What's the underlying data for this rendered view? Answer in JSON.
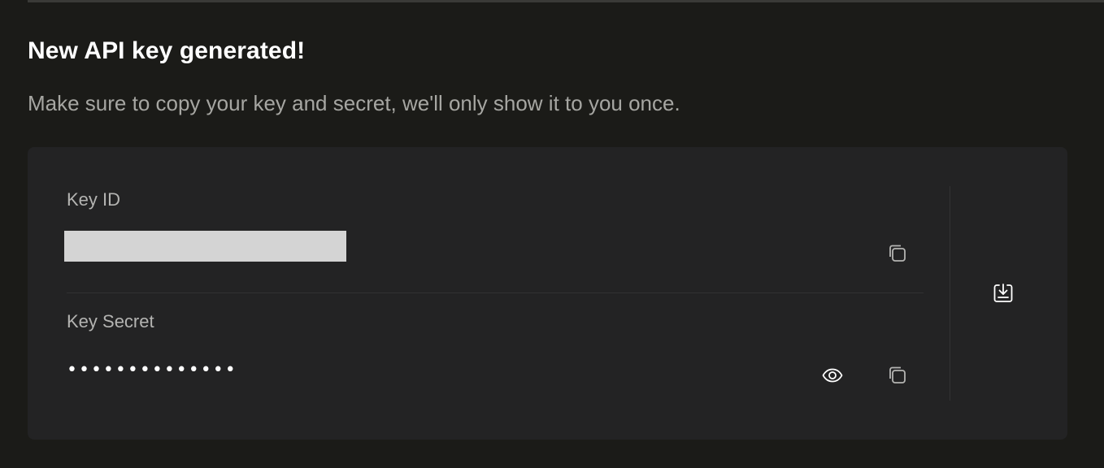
{
  "dialog": {
    "title": "New API key generated!",
    "subtitle": "Make sure to copy your key and secret, we'll only show it to you once."
  },
  "fields": {
    "key_id": {
      "label": "Key ID",
      "value": ""
    },
    "key_secret": {
      "label": "Key Secret",
      "value": "••••••••••••••"
    }
  },
  "icons": {
    "copy": "copy-icon",
    "reveal": "eye-icon",
    "download": "download-icon"
  },
  "colors": {
    "background": "#1b1b18",
    "card": "#232324",
    "title": "#ffffff",
    "subtitle": "#a6a6a2",
    "label": "#b4b4b2",
    "redaction": "#d4d4d4"
  }
}
